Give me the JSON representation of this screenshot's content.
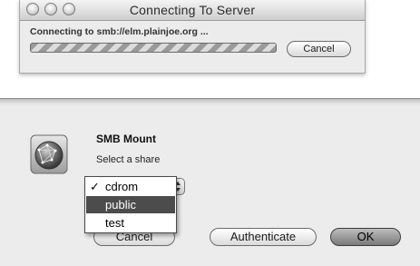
{
  "connecting_window": {
    "title": "Connecting To Server",
    "status": "Connecting to smb://elm.plainjoe.org ...",
    "cancel_label": "Cancel"
  },
  "smb_sheet": {
    "title": "SMB Mount",
    "subtitle": "Select a share",
    "share_menu": {
      "check_glyph": "✓",
      "items": [
        {
          "label": "cdrom",
          "checked": true,
          "highlighted": false
        },
        {
          "label": "public",
          "checked": false,
          "highlighted": true
        },
        {
          "label": "test",
          "checked": false,
          "highlighted": false
        }
      ]
    },
    "cancel_label": "Cancel",
    "authenticate_label": "Authenticate",
    "ok_label": "OK"
  },
  "icons": {
    "traffic_lights": "window-control-icon",
    "server": "network-globe-icon",
    "popup_arrows": "popup-arrows-icon"
  }
}
